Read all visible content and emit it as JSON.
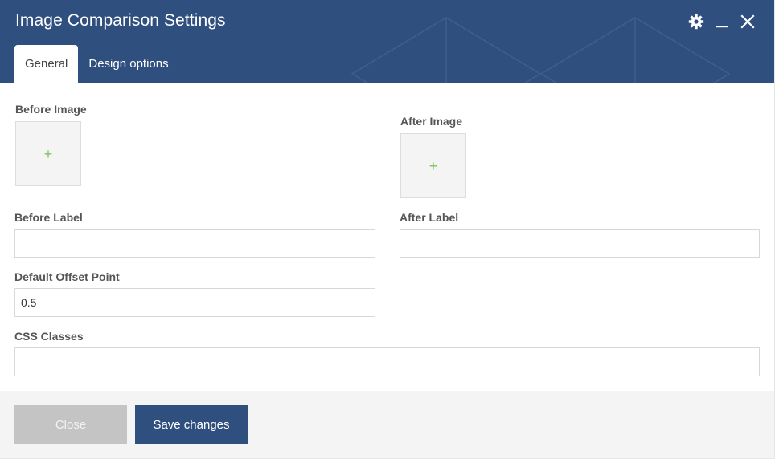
{
  "window": {
    "title": "Image Comparison Settings",
    "icons": [
      "gear-icon",
      "minimize-icon",
      "close-icon"
    ]
  },
  "tabs": [
    {
      "label": "General",
      "active": true
    },
    {
      "label": "Design options",
      "active": false
    }
  ],
  "form": {
    "before_image": {
      "label": "Before Image",
      "add_glyph": "+"
    },
    "after_image": {
      "label": "After Image",
      "add_glyph": "+"
    },
    "before_label": {
      "label": "Before Label",
      "value": ""
    },
    "after_label": {
      "label": "After Label",
      "value": ""
    },
    "offset": {
      "label": "Default Offset Point",
      "value": "0.5"
    },
    "css_classes": {
      "label": "CSS Classes",
      "value": ""
    }
  },
  "footer": {
    "close_label": "Close",
    "save_label": "Save changes"
  },
  "colors": {
    "header_bg": "#2f4f7f",
    "save_button": "#2f4f7f",
    "close_button": "#c4c4c4",
    "plus_icon": "#7dc45a"
  }
}
